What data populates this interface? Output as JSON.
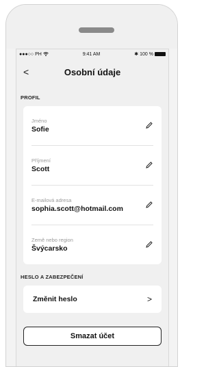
{
  "status_bar": {
    "carrier": "●●●○○ PH",
    "wifi": "wifi-icon",
    "time": "9:41 AM",
    "bluetooth": "✱",
    "battery": "100 %"
  },
  "header": {
    "back_label": "<",
    "title": "Osobní údaje"
  },
  "profile_section": {
    "heading": "PROFIL",
    "fields": [
      {
        "label": "Jméno",
        "value": "Sofie"
      },
      {
        "label": "Příjmení",
        "value": "Scott"
      },
      {
        "label": "E-mailová adresa",
        "value": "sophia.scott@hotmail.com"
      },
      {
        "label": "Země nebo region",
        "value": "Švýcarsko"
      }
    ]
  },
  "security_section": {
    "heading": "HESLO A ZABEZPEČENÍ",
    "change_password": "Změnit heslo",
    "chevron": ">"
  },
  "delete_account": "Smazat účet",
  "colors": {
    "background": "#f0f0f0",
    "card": "#ffffff",
    "text": "#111111",
    "label": "#9a9a9a"
  }
}
